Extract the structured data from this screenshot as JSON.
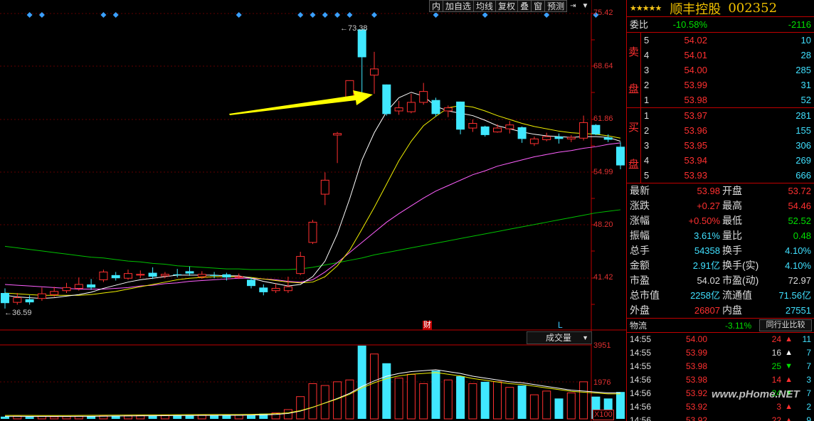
{
  "toolbar": {
    "buttons": [
      "内",
      "加自选",
      "均线",
      "复权",
      "叠",
      "窗",
      "预测"
    ],
    "pin_icon": "pin-icon",
    "menu_icon": "chevron-down-icon"
  },
  "price_axis": [
    "75.42",
    "68.64",
    "61.86",
    "54.99",
    "48.20",
    "41.42"
  ],
  "volume_axis": [
    "3951",
    "1976"
  ],
  "volume_multiplier": "X100",
  "volume_selector": "成交量",
  "high_annotation": "73.38",
  "low_annotation": "36.59",
  "event_markers": {
    "finance": "财",
    "l": "L"
  },
  "colors": {
    "up": "#ff3030",
    "down": "#40e8ff",
    "ma5": "#ffffff",
    "ma10": "#f0f000",
    "ma20": "#ff60ff",
    "ma60": "#00c000",
    "arrow": "#ffff00",
    "border": "#c00000"
  },
  "chart_data": {
    "type": "candlestick",
    "ylim": [
      36.0,
      75.42
    ],
    "candles": [
      {
        "o": 39.5,
        "c": 38.2,
        "h": 40.1,
        "l": 37.5
      },
      {
        "o": 38.3,
        "c": 38.9,
        "h": 39.5,
        "l": 38.0
      },
      {
        "o": 38.7,
        "c": 38.3,
        "h": 39.2,
        "l": 38.0
      },
      {
        "o": 38.8,
        "c": 39.4,
        "h": 40.2,
        "l": 38.5
      },
      {
        "o": 39.3,
        "c": 39.7,
        "h": 40.3,
        "l": 39.0
      },
      {
        "o": 39.8,
        "c": 40.2,
        "h": 40.8,
        "l": 39.5
      },
      {
        "o": 40.1,
        "c": 40.6,
        "h": 41.5,
        "l": 39.8
      },
      {
        "o": 40.6,
        "c": 40.2,
        "h": 41.3,
        "l": 39.9
      },
      {
        "o": 41.2,
        "c": 42.2,
        "h": 42.5,
        "l": 40.9
      },
      {
        "o": 41.8,
        "c": 41.4,
        "h": 42.2,
        "l": 41.1
      },
      {
        "o": 41.4,
        "c": 42.0,
        "h": 42.5,
        "l": 41.2
      },
      {
        "o": 41.8,
        "c": 41.9,
        "h": 42.4,
        "l": 41.4
      },
      {
        "o": 42.1,
        "c": 41.6,
        "h": 42.8,
        "l": 41.3
      },
      {
        "o": 41.7,
        "c": 41.9,
        "h": 42.2,
        "l": 41.4
      },
      {
        "o": 41.9,
        "c": 41.8,
        "h": 42.6,
        "l": 41.5
      },
      {
        "o": 42.3,
        "c": 42.0,
        "h": 42.9,
        "l": 41.7
      },
      {
        "o": 41.6,
        "c": 41.9,
        "h": 42.3,
        "l": 41.3
      },
      {
        "o": 41.8,
        "c": 41.7,
        "h": 42.2,
        "l": 41.4
      },
      {
        "o": 41.9,
        "c": 41.5,
        "h": 42.1,
        "l": 41.1
      },
      {
        "o": 41.5,
        "c": 41.6,
        "h": 42.0,
        "l": 41.3
      },
      {
        "o": 41.2,
        "c": 40.4,
        "h": 41.5,
        "l": 40.1
      },
      {
        "o": 40.2,
        "c": 39.6,
        "h": 40.6,
        "l": 39.2
      },
      {
        "o": 39.8,
        "c": 40.1,
        "h": 40.7,
        "l": 39.5
      },
      {
        "o": 39.8,
        "c": 40.3,
        "h": 41.6,
        "l": 39.5
      },
      {
        "o": 42.0,
        "c": 44.2,
        "h": 44.8,
        "l": 41.8
      },
      {
        "o": 46.0,
        "c": 48.6,
        "h": 48.9,
        "l": 45.8
      },
      {
        "o": 52.2,
        "c": 54.0,
        "h": 55.0,
        "l": 50.8
      },
      {
        "o": 59.8,
        "c": 60.0,
        "h": 60.2,
        "l": 56.2
      },
      {
        "o": 64.7,
        "c": 66.8,
        "h": 66.8,
        "l": 64.2
      },
      {
        "o": 73.38,
        "c": 69.8,
        "h": 73.38,
        "l": 64.8
      },
      {
        "o": 67.5,
        "c": 68.3,
        "h": 70.5,
        "l": 65.1
      },
      {
        "o": 66.3,
        "c": 62.5,
        "h": 66.3,
        "l": 62.3
      },
      {
        "o": 62.9,
        "c": 63.3,
        "h": 64.2,
        "l": 62.4
      },
      {
        "o": 62.8,
        "c": 64.0,
        "h": 65.1,
        "l": 62.6
      },
      {
        "o": 64.0,
        "c": 65.4,
        "h": 66.5,
        "l": 63.7
      },
      {
        "o": 64.3,
        "c": 62.5,
        "h": 64.6,
        "l": 62.2
      },
      {
        "o": 62.9,
        "c": 63.3,
        "h": 63.6,
        "l": 62.1
      },
      {
        "o": 64.1,
        "c": 60.5,
        "h": 64.1,
        "l": 59.9
      },
      {
        "o": 60.7,
        "c": 61.3,
        "h": 61.8,
        "l": 60.2
      },
      {
        "o": 60.9,
        "c": 59.8,
        "h": 61.0,
        "l": 59.6
      },
      {
        "o": 60.2,
        "c": 60.7,
        "h": 61.2,
        "l": 60.1
      },
      {
        "o": 60.6,
        "c": 61.1,
        "h": 61.6,
        "l": 60.0
      },
      {
        "o": 60.8,
        "c": 59.3,
        "h": 60.9,
        "l": 58.8
      },
      {
        "o": 58.7,
        "c": 59.3,
        "h": 59.6,
        "l": 58.4
      },
      {
        "o": 59.2,
        "c": 59.6,
        "h": 60.1,
        "l": 59.0
      },
      {
        "o": 59.6,
        "c": 59.3,
        "h": 60.0,
        "l": 58.7
      },
      {
        "o": 59.3,
        "c": 59.5,
        "h": 59.8,
        "l": 58.9
      },
      {
        "o": 59.4,
        "c": 61.4,
        "h": 62.3,
        "l": 59.1
      },
      {
        "o": 61.1,
        "c": 59.9,
        "h": 61.2,
        "l": 59.8
      },
      {
        "o": 59.5,
        "c": 59.2,
        "h": 59.9,
        "l": 58.9
      },
      {
        "o": 58.3,
        "c": 55.9,
        "h": 58.9,
        "l": 55.4
      }
    ],
    "ma5": [
      39.2,
      39.0,
      38.9,
      38.8,
      38.9,
      39.1,
      39.3,
      39.6,
      40.1,
      40.5,
      40.9,
      41.2,
      41.4,
      41.6,
      41.8,
      41.8,
      41.8,
      41.8,
      41.7,
      41.7,
      41.4,
      41.0,
      40.7,
      40.4,
      40.6,
      41.6,
      43.6,
      47.1,
      51.6,
      56.6,
      60.1,
      62.8,
      64.6,
      65.3,
      64.8,
      63.5,
      62.9,
      62.6,
      62.3,
      61.7,
      61.0,
      60.6,
      60.2,
      59.9,
      59.7,
      59.6,
      59.5,
      59.6,
      59.6,
      59.5,
      59.0
    ],
    "ma10": [
      39.5,
      39.4,
      39.3,
      39.2,
      39.2,
      39.2,
      39.2,
      39.3,
      39.5,
      39.7,
      40.0,
      40.3,
      40.6,
      40.9,
      41.2,
      41.4,
      41.5,
      41.6,
      41.6,
      41.6,
      41.5,
      41.3,
      41.1,
      40.9,
      40.8,
      40.9,
      41.6,
      43.0,
      45.0,
      47.7,
      50.5,
      53.5,
      56.5,
      59.0,
      61.0,
      62.2,
      63.3,
      63.6,
      63.4,
      62.9,
      62.3,
      61.8,
      61.3,
      60.9,
      60.6,
      60.3,
      60.1,
      60.0,
      59.9,
      59.7,
      59.4
    ],
    "ma20": [
      40.6,
      40.5,
      40.4,
      40.3,
      40.2,
      40.1,
      40.0,
      40.0,
      40.0,
      40.1,
      40.2,
      40.4,
      40.5,
      40.7,
      40.8,
      41.0,
      41.1,
      41.2,
      41.3,
      41.4,
      41.4,
      41.3,
      41.2,
      41.0,
      40.9,
      41.2,
      42.2,
      43.4,
      44.7,
      46.0,
      47.3,
      48.6,
      49.7,
      50.7,
      51.7,
      52.6,
      53.3,
      54.0,
      54.7,
      55.2,
      55.8,
      56.2,
      56.6,
      57.0,
      57.3,
      57.6,
      57.8,
      58.1,
      58.3,
      58.6,
      58.8
    ],
    "ma60": [
      45.5,
      45.3,
      45.1,
      44.9,
      44.7,
      44.5,
      44.3,
      44.1,
      44.0,
      43.8,
      43.6,
      43.5,
      43.3,
      43.2,
      43.0,
      42.9,
      42.8,
      42.7,
      42.6,
      42.6,
      42.5,
      42.5,
      42.5,
      42.5,
      42.6,
      42.8,
      43.1,
      43.4,
      43.7,
      44.0,
      44.4,
      44.7,
      45.0,
      45.3,
      45.6,
      45.9,
      46.2,
      46.5,
      46.8,
      47.1,
      47.4,
      47.7,
      48.0,
      48.3,
      48.6,
      48.9,
      49.2,
      49.5,
      49.8,
      50.0,
      50.2
    ],
    "volume": [
      120,
      140,
      110,
      130,
      115,
      125,
      135,
      150,
      160,
      170,
      165,
      180,
      170,
      185,
      175,
      190,
      200,
      180,
      175,
      195,
      210,
      280,
      320,
      500,
      1200,
      1900,
      1800,
      2000,
      2100,
      3951,
      3500,
      3000,
      2200,
      2400,
      1900,
      2600,
      2100,
      2300,
      1900,
      2000,
      2000,
      1700,
      1800,
      1300,
      1500,
      1100,
      1400,
      2000,
      1200,
      1100,
      1450
    ],
    "volume_ma": [
      140,
      138,
      136,
      134,
      133,
      134,
      137,
      141,
      146,
      152,
      158,
      164,
      170,
      175,
      180,
      184,
      186,
      188,
      190,
      192,
      200,
      215,
      240,
      290,
      420,
      620,
      860,
      1100,
      1380,
      1750,
      2050,
      2300,
      2450,
      2550,
      2600,
      2650,
      2550,
      2450,
      2300,
      2200,
      2100,
      2000,
      1950,
      1850,
      1750,
      1650,
      1550,
      1500,
      1450,
      1400,
      1400
    ],
    "diamond_markers": [
      2,
      3,
      8,
      9,
      19,
      24,
      25,
      26,
      27,
      28,
      30,
      35,
      39,
      44,
      48
    ],
    "vol_ylim": [
      0,
      3951
    ]
  },
  "panel": {
    "stars": "★★★★★",
    "name": "顺丰控股",
    "code": "002352",
    "weibi_label": "委比",
    "weibi_pct": "-10.58%",
    "weibi_diff": "-2116",
    "sell_label": [
      "卖",
      "盘"
    ],
    "buy_label": [
      "买",
      "盘"
    ],
    "sell": [
      {
        "lvl": "5",
        "price": "54.02",
        "vol": "10"
      },
      {
        "lvl": "4",
        "price": "54.01",
        "vol": "28"
      },
      {
        "lvl": "3",
        "price": "54.00",
        "vol": "285"
      },
      {
        "lvl": "2",
        "price": "53.99",
        "vol": "31"
      },
      {
        "lvl": "1",
        "price": "53.98",
        "vol": "52"
      }
    ],
    "buy": [
      {
        "lvl": "1",
        "price": "53.97",
        "vol": "281"
      },
      {
        "lvl": "2",
        "price": "53.96",
        "vol": "155"
      },
      {
        "lvl": "3",
        "price": "53.95",
        "vol": "306"
      },
      {
        "lvl": "4",
        "price": "53.94",
        "vol": "269"
      },
      {
        "lvl": "5",
        "price": "53.93",
        "vol": "666"
      }
    ],
    "stats": [
      {
        "l1": "最新",
        "v1": "53.98",
        "c1": "red",
        "l2": "开盘",
        "v2": "53.72",
        "c2": "red"
      },
      {
        "l1": "涨跌",
        "v1": "+0.27",
        "c1": "red",
        "l2": "最高",
        "v2": "54.46",
        "c2": "red"
      },
      {
        "l1": "涨幅",
        "v1": "+0.50%",
        "c1": "red",
        "l2": "最低",
        "v2": "52.52",
        "c2": "green"
      },
      {
        "l1": "振幅",
        "v1": "3.61%",
        "c1": "cyan",
        "l2": "量比",
        "v2": "0.48",
        "c2": "green"
      },
      {
        "l1": "总手",
        "v1": "54358",
        "c1": "cyan",
        "l2": "换手",
        "v2": "4.10%",
        "c2": "cyan"
      },
      {
        "l1": "金额",
        "v1": "2.91亿",
        "c1": "cyan",
        "l2": "换手(实)",
        "v2": "4.10%",
        "c2": "cyan"
      },
      {
        "l1": "市盈",
        "v1": "54.02",
        "c1": "white",
        "l2": "市盈(动)",
        "v2": "72.97",
        "c2": "white"
      },
      {
        "l1": "总市值",
        "v1": "2258亿",
        "c1": "cyan",
        "l2": "流通值",
        "v2": "71.56亿",
        "c2": "cyan"
      },
      {
        "l1": "外盘",
        "v1": "26807",
        "c1": "red",
        "l2": "内盘",
        "v2": "27551",
        "c2": "cyan"
      }
    ],
    "sector_label": "物流",
    "sector_pct": "-3.11%",
    "compare_button": "同行业比较",
    "ticks": [
      {
        "time": "14:55",
        "price": "54.00",
        "vol": "24",
        "dir": "up",
        "n": "11"
      },
      {
        "time": "14:55",
        "price": "53.99",
        "vol": "16",
        "dir": "neutral",
        "n": "7"
      },
      {
        "time": "14:55",
        "price": "53.98",
        "vol": "25",
        "dir": "down",
        "n": "7"
      },
      {
        "time": "14:56",
        "price": "53.98",
        "vol": "14",
        "dir": "up",
        "n": "3"
      },
      {
        "time": "14:56",
        "price": "53.92",
        "vol": "24",
        "dir": "down",
        "n": "7"
      },
      {
        "time": "14:56",
        "price": "53.92",
        "vol": "3",
        "dir": "up",
        "n": "2"
      },
      {
        "time": "14:56",
        "price": "53.92",
        "vol": "22",
        "dir": "up",
        "n": "9"
      }
    ]
  },
  "watermark": "www.pHome.NET"
}
